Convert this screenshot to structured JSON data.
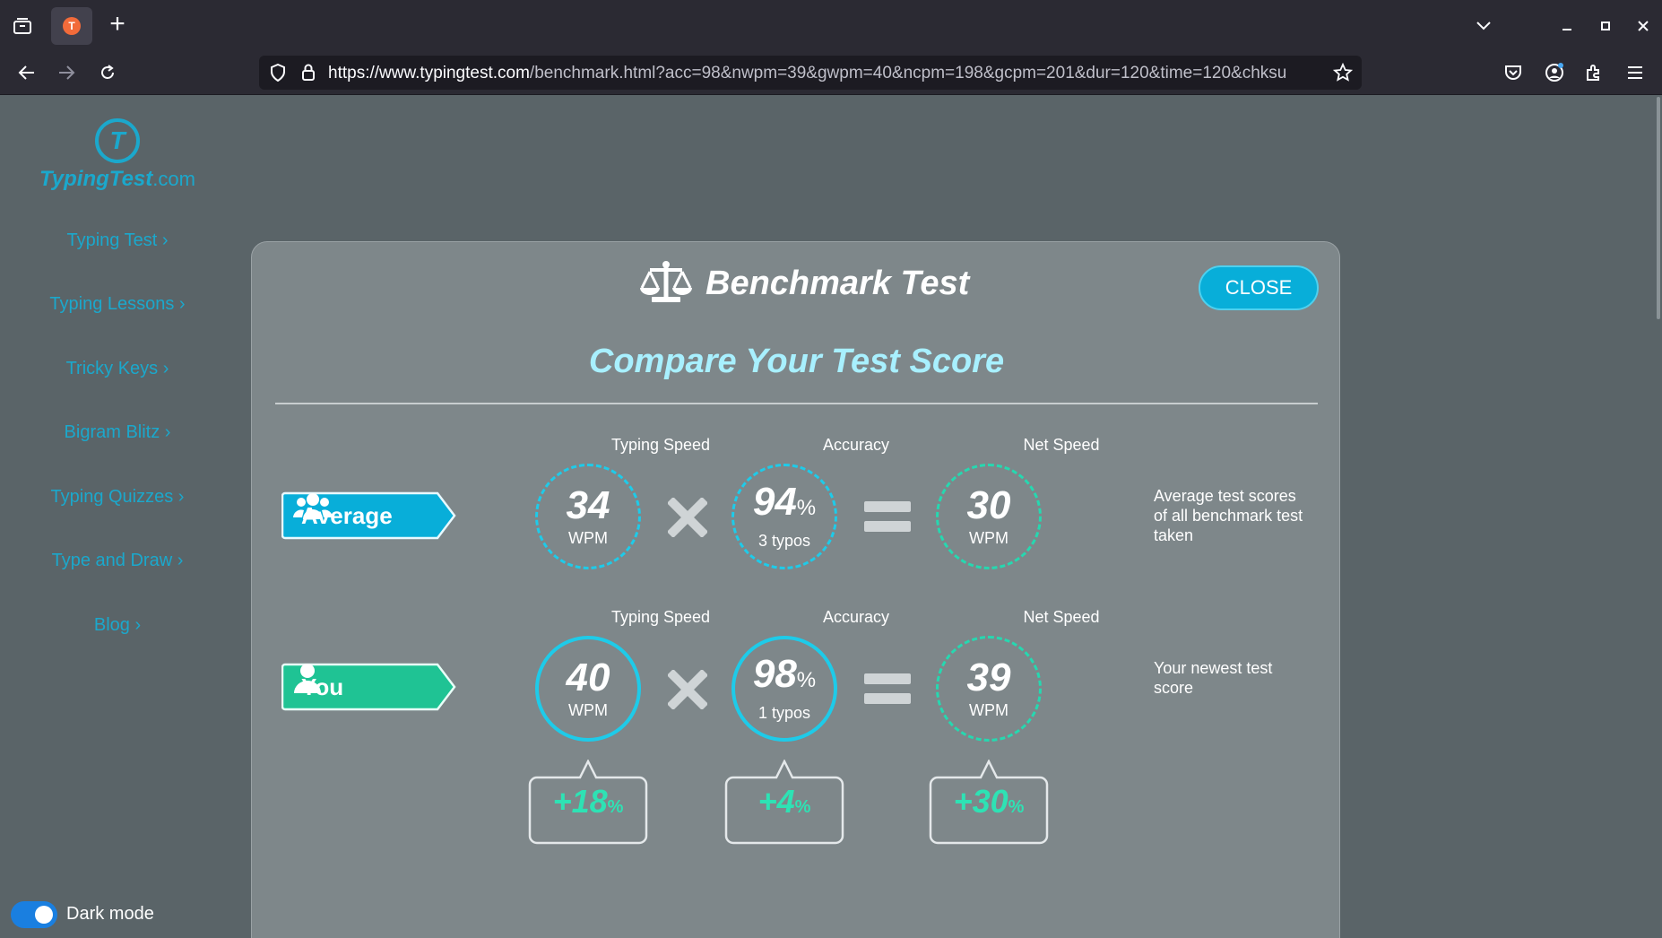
{
  "browser": {
    "url_host": "https://www.typingtest.com",
    "url_path": "/benchmark.html?acc=98&nwpm=39&gwpm=40&ncpm=198&gcpm=201&dur=120&time=120&chksu",
    "new_tab": "+"
  },
  "logo": {
    "name": "TypingTest",
    "suffix": ".com"
  },
  "sidebar": {
    "items": [
      {
        "label": "Typing Test ›"
      },
      {
        "label": "Typing Lessons ›"
      },
      {
        "label": "Tricky Keys ›"
      },
      {
        "label": "Bigram Blitz ›"
      },
      {
        "label": "Typing Quizzes ›"
      },
      {
        "label": "Type and Draw ›"
      },
      {
        "label": "Blog ›"
      }
    ],
    "dark_mode_label": "Dark mode",
    "dark_mode_on": true
  },
  "modal": {
    "title": "Benchmark Test",
    "close_label": "CLOSE",
    "subtitle": "Compare Your Test Score",
    "average": {
      "label": "Average",
      "typing_speed_head": "Typing Speed",
      "typing_speed": "34",
      "typing_speed_unit": "WPM",
      "accuracy_head": "Accuracy",
      "accuracy": "94",
      "accuracy_pct": "%",
      "accuracy_typos": "3 typos",
      "net_speed_head": "Net Speed",
      "net_speed": "30",
      "net_speed_unit": "WPM",
      "note": "Average test scores of all benchmark test taken"
    },
    "you": {
      "label": "You",
      "typing_speed_head": "Typing Speed",
      "typing_speed": "40",
      "typing_speed_unit": "WPM",
      "accuracy_head": "Accuracy",
      "accuracy": "98",
      "accuracy_pct": "%",
      "accuracy_typos": "1 typos",
      "net_speed_head": "Net Speed",
      "net_speed": "39",
      "net_speed_unit": "WPM",
      "note": "Your newest test score"
    },
    "deltas": {
      "typing_speed": "+18",
      "accuracy": "+4",
      "net_speed": "+30",
      "pct": "%"
    }
  },
  "colors": {
    "accent_blue": "#08aed9",
    "accent_green": "#1fc394",
    "delta_green": "#2ee2b4",
    "sidebar_link": "#1ba8cc"
  }
}
